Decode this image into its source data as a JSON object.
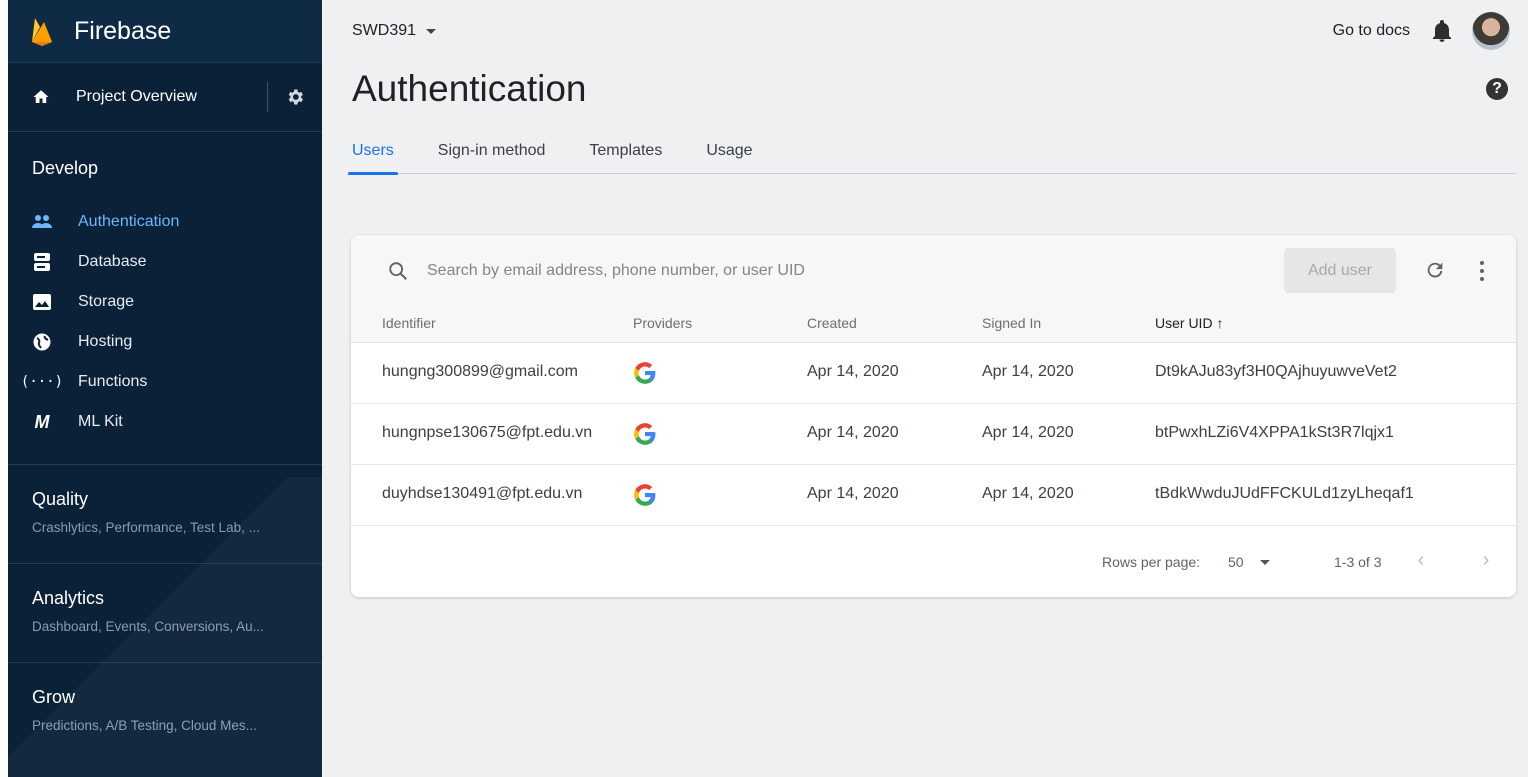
{
  "brand": {
    "name": "Firebase"
  },
  "sidebar": {
    "overview_label": "Project Overview",
    "section_title": "Develop",
    "items": [
      {
        "label": "Authentication",
        "icon": "users-icon",
        "active": true
      },
      {
        "label": "Database",
        "icon": "database-icon",
        "active": false
      },
      {
        "label": "Storage",
        "icon": "image-icon",
        "active": false
      },
      {
        "label": "Hosting",
        "icon": "globe-icon",
        "active": false
      },
      {
        "label": "Functions",
        "icon": "functions-icon",
        "active": false
      },
      {
        "label": "ML Kit",
        "icon": "mlkit-icon",
        "active": false
      }
    ],
    "groups": [
      {
        "title": "Quality",
        "subtitle": "Crashlytics, Performance, Test Lab, ..."
      },
      {
        "title": "Analytics",
        "subtitle": "Dashboard, Events, Conversions, Au..."
      },
      {
        "title": "Grow",
        "subtitle": "Predictions, A/B Testing, Cloud Mes..."
      }
    ]
  },
  "topbar": {
    "project": "SWD391",
    "docs_link": "Go to docs"
  },
  "page": {
    "title": "Authentication"
  },
  "tabs": [
    {
      "label": "Users",
      "active": true
    },
    {
      "label": "Sign-in method",
      "active": false
    },
    {
      "label": "Templates",
      "active": false
    },
    {
      "label": "Usage",
      "active": false
    }
  ],
  "table": {
    "search_placeholder": "Search by email address, phone number, or user UID",
    "add_user_label": "Add user",
    "columns": [
      "Identifier",
      "Providers",
      "Created",
      "Signed In",
      "User UID ↑"
    ],
    "rows": [
      {
        "identifier": "hungng300899@gmail.com",
        "provider": "google-icon",
        "created": "Apr 14, 2020",
        "signed_in": "Apr 14, 2020",
        "uid": "Dt9kAJu83yf3H0QAjhuyuwveVet2"
      },
      {
        "identifier": "hungnpse130675@fpt.edu.vn",
        "provider": "google-icon",
        "created": "Apr 14, 2020",
        "signed_in": "Apr 14, 2020",
        "uid": "btPwxhLZi6V4XPPA1kSt3R7lqjx1"
      },
      {
        "identifier": "duyhdse130491@fpt.edu.vn",
        "provider": "google-icon",
        "created": "Apr 14, 2020",
        "signed_in": "Apr 14, 2020",
        "uid": "tBdkWwduJUdFFCKULd1zyLheqaf1"
      }
    ],
    "footer": {
      "rows_per_page_label": "Rows per page:",
      "rows_per_page_value": "50",
      "range": "1-3 of 3"
    }
  },
  "colors": {
    "sidebar_bg": "#0b2137",
    "accent": "#1a73e8",
    "active_nav": "#6ab7ff"
  }
}
